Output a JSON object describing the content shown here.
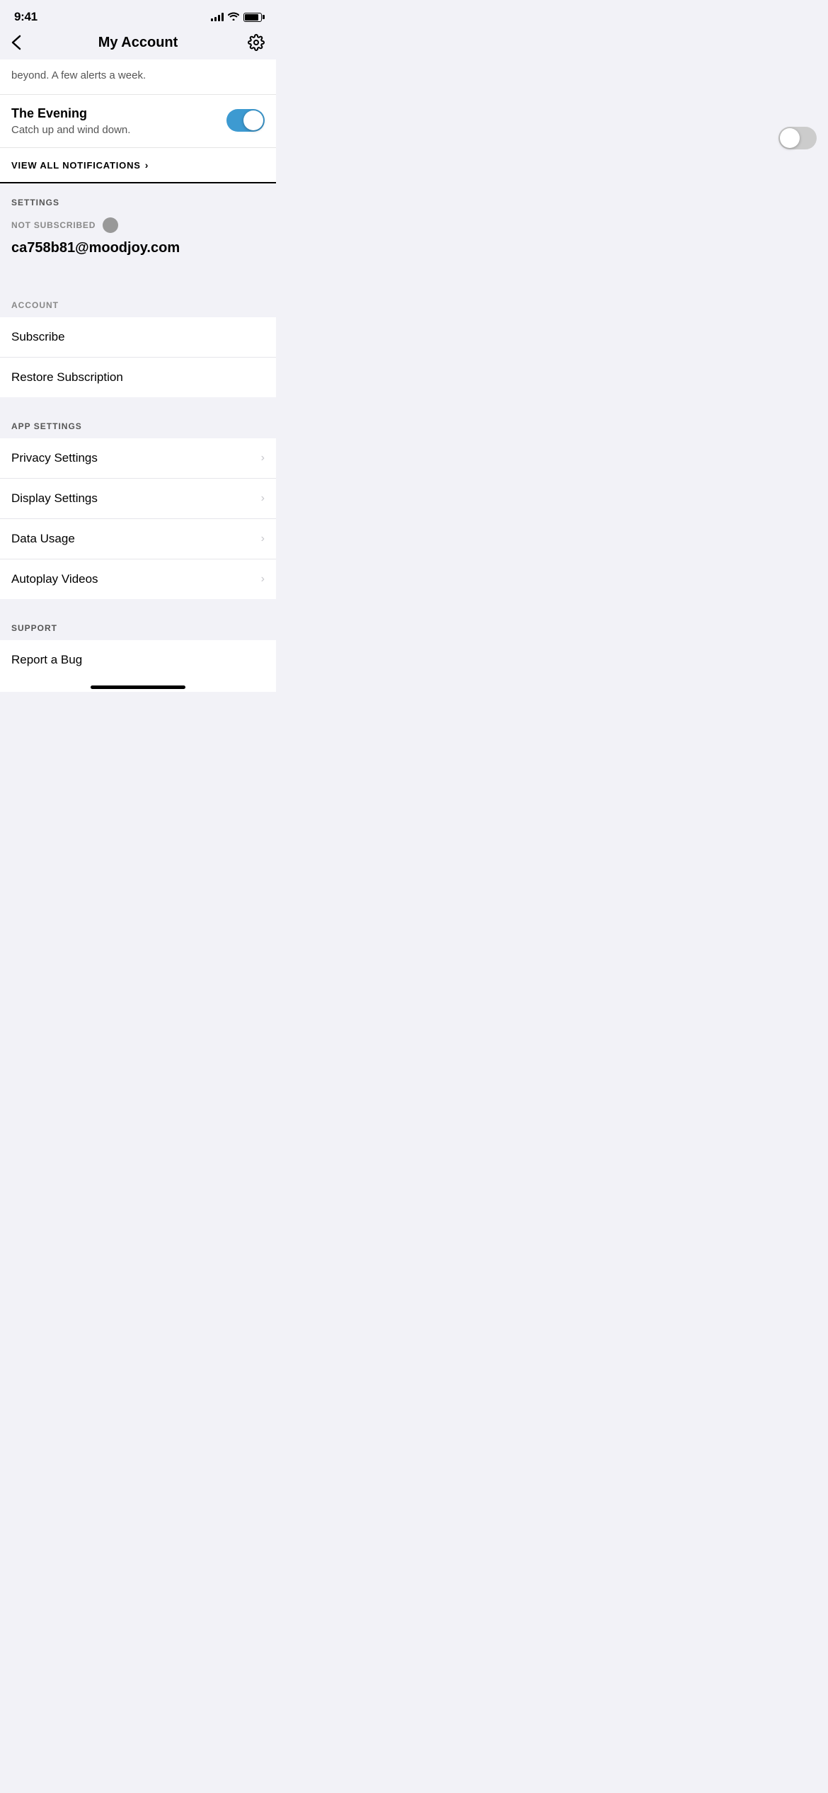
{
  "statusBar": {
    "time": "9:41"
  },
  "header": {
    "back_label": "<",
    "title": "My Account",
    "gear_label": "⚙"
  },
  "partialContent": {
    "text": "beyond. A few alerts a week."
  },
  "eveningNotification": {
    "title": "The Evening",
    "description": "Catch up and wind down.",
    "toggle_on": true
  },
  "viewAllNotifications": {
    "label": "VIEW ALL NOTIFICATIONS",
    "chevron": "›"
  },
  "settingsSection": {
    "header": "SETTINGS",
    "subscriptionStatus": "NOT SUBSCRIBED",
    "email": "ca758b81@moodjoy.com"
  },
  "accountSection": {
    "header": "ACCOUNT",
    "items": [
      {
        "label": "Subscribe",
        "hasChevron": false
      },
      {
        "label": "Restore Subscription",
        "hasChevron": false
      }
    ]
  },
  "appSettingsSection": {
    "header": "APP SETTINGS",
    "items": [
      {
        "label": "Privacy Settings",
        "hasChevron": true,
        "chevron": "›"
      },
      {
        "label": "Display Settings",
        "hasChevron": true,
        "chevron": "›"
      },
      {
        "label": "Data Usage",
        "hasChevron": true,
        "chevron": "›"
      },
      {
        "label": "Autoplay Videos",
        "hasChevron": true,
        "chevron": "›"
      }
    ]
  },
  "supportSection": {
    "header": "SUPPORT",
    "items": [
      {
        "label": "Report a Bug",
        "hasChevron": false
      }
    ]
  }
}
